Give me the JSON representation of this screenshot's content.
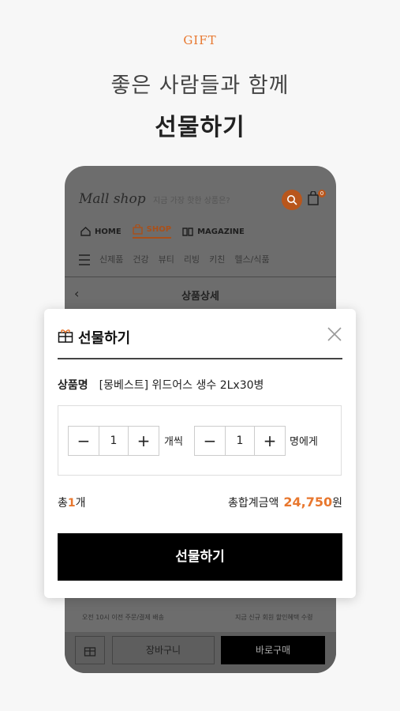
{
  "promo": {
    "label": "GIFT",
    "subtitle": "좋은 사람들과 함께",
    "title": "선물하기"
  },
  "app": {
    "logo": "Mall shop",
    "search_placeholder": "지금 가장 핫한 상품은?",
    "cart_count": "0",
    "nav": [
      {
        "label": "HOME",
        "icon": "home-icon"
      },
      {
        "label": "SHOP",
        "icon": "shopping-bag-icon"
      },
      {
        "label": "MAGAZINE",
        "icon": "book-icon"
      }
    ],
    "categories": [
      "신제품",
      "건강",
      "뷰티",
      "리빙",
      "키친",
      "헬스/식품"
    ],
    "page_title": "상품상세",
    "promo_strip": [
      "오전 10시 이전 주문/결제 배송",
      "",
      "",
      "지금 신규 회원 할인혜택 수령"
    ],
    "bottom": {
      "cart_label": "장바구니",
      "buy_label": "바로구매"
    }
  },
  "modal": {
    "title": "선물하기",
    "product_label": "상품명",
    "product_name": "[몽베스트] 위드어스 생수 2Lx30병",
    "qty": {
      "minus": "−",
      "value": "1",
      "plus": "+",
      "unit": "개씩"
    },
    "people": {
      "minus": "−",
      "value": "1",
      "plus": "+",
      "unit": "명에게"
    },
    "total_prefix": "총",
    "total_count": "1",
    "total_suffix": "개",
    "sum_label": "총합계금액",
    "sum_value": "24,750",
    "sum_unit": "원",
    "submit_label": "선물하기"
  },
  "colors": {
    "accent": "#e8772e",
    "dark": "#000000",
    "overlay": "#6d6d6d"
  }
}
